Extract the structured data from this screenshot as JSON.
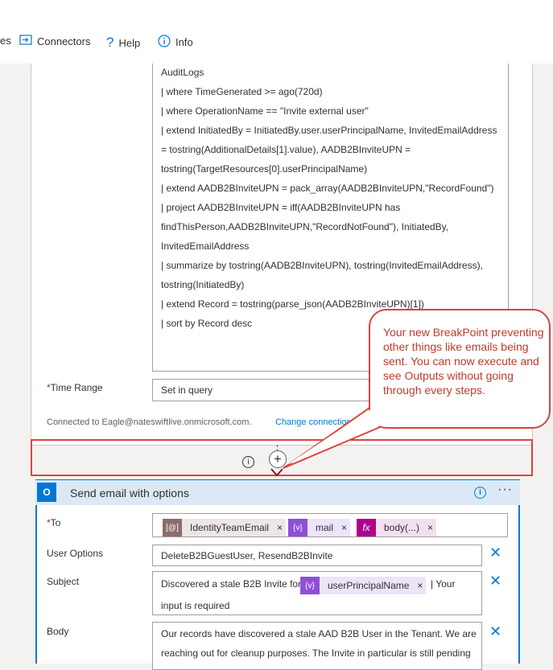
{
  "toolbar": {
    "partial_label": "es",
    "connectors_label": "Connectors",
    "help_label": "Help",
    "info_label": "Info"
  },
  "query_action": {
    "query_lines": [
      "AuditLogs",
      "| where TimeGenerated >= ago(720d)",
      "| where OperationName == \"Invite external user\"",
      "| extend InitiatedBy = InitiatedBy.user.userPrincipalName, InvitedEmailAddress",
      "= tostring(AdditionalDetails[1].value), AADB2BInviteUPN =",
      "tostring(TargetResources[0].userPrincipalName)",
      "| extend  AADB2BInviteUPN = pack_array(AADB2BInviteUPN,\"RecordFound\")",
      "| project AADB2BInviteUPN = iff(AADB2BInviteUPN has",
      "findThisPerson,AADB2BInviteUPN,\"RecordNotFound\"), InitiatedBy,",
      "InvitedEmailAddress",
      "| summarize by tostring(AADB2BInviteUPN), tostring(InvitedEmailAddress),",
      "tostring(InitiatedBy)",
      "| extend Record = tostring(parse_json(AADB2BInviteUPN)[1])",
      "| sort by Record desc"
    ],
    "time_range_label": "Time Range",
    "time_range_value": "Set in query",
    "connected_text": "Connected to Eagle@nateswiftlive.onmicrosoft.com.",
    "change_connection": "Change connection."
  },
  "callout": {
    "text": "Your new BreakPoint preventing other things like emails being sent. You can now execute and see Outputs without going through every steps."
  },
  "send_email": {
    "title": "Send email with options",
    "to_label": "To",
    "to_tokens": [
      {
        "label": "IdentityTeamEmail",
        "icon": "variable-icon",
        "color": "#8c6c6c",
        "bg": "#ede6e6"
      },
      {
        "label": "mail",
        "icon": "curly-braces-icon",
        "color": "#8e4fd6",
        "bg": "#ece4f8"
      },
      {
        "label": "body(...)",
        "icon": "fx-icon",
        "color": "#ad008c",
        "bg": "#f3e0ee"
      }
    ],
    "user_options_label": "User Options",
    "user_options_value": "DeleteB2BGuestUser, ResendB2BInvite",
    "subject_label": "Subject",
    "subject_prefix": "Discovered a stale B2B Invite for",
    "subject_token": "userPrincipalName",
    "subject_suffix_1": "| Your",
    "subject_suffix_2": "input is required",
    "body_label": "Body",
    "body_line_1": "Our records have discovered a stale AAD B2B User in the Tenant. We are",
    "body_line_2": "reaching out for cleanup purposes. The Invite in particular is still pending"
  },
  "colors": {
    "accent": "#0078d4",
    "callout_border": "#d9443d",
    "callout_text": "#c0392b"
  }
}
